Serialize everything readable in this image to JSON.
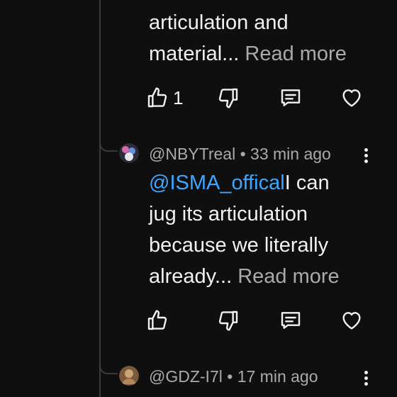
{
  "comments": [
    {
      "text": "articulation and\nmaterial...",
      "read_more": "Read more",
      "like_count": "1"
    },
    {
      "author": "@NBYTreal",
      "separator": "•",
      "time": "33 min ago",
      "mention": "@ISMA_offical",
      "text": "I can\njug its articulation\nbecause we literally\nalready...",
      "read_more": "Read more",
      "like_count": ""
    },
    {
      "author": "@GDZ-I7l",
      "separator": "•",
      "time": "17 min ago"
    }
  ],
  "icons": {
    "like": "thumbs-up-icon",
    "dislike": "thumbs-down-icon",
    "reply": "comment-icon",
    "heart": "heart-icon",
    "more": "more-vertical-icon"
  },
  "colors": {
    "background": "#0f0f0f",
    "text": "#f1f1f1",
    "secondary": "#aaaaaa",
    "mention": "#3ea6ff",
    "thread_line": "#3a3a3a"
  }
}
